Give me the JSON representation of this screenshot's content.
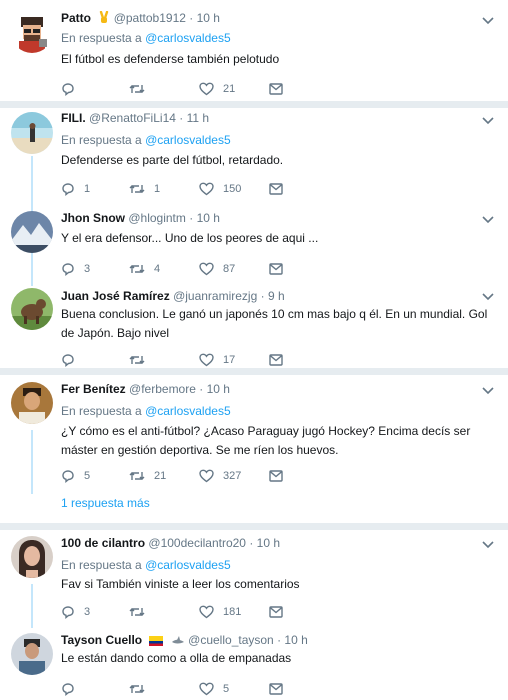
{
  "tweets": [
    {
      "name": "Patto",
      "handle": "@pattob1912",
      "time": "10 h",
      "reply_prefix": "En respuesta a",
      "reply_to": "@carlosvaldes5",
      "text": "El fútbol es defenderse también pelotudo",
      "replies": "",
      "retweets": "",
      "likes": "21"
    },
    {
      "name": "FILI.",
      "handle": "@RenattoFiLi14",
      "time": "11 h",
      "reply_prefix": "En respuesta a",
      "reply_to": "@carlosvaldes5",
      "text": "Defenderse es parte del fútbol, retardado.",
      "replies": "1",
      "retweets": "1",
      "likes": "150"
    },
    {
      "name": "Jhon Snow",
      "handle": "@hlogintm",
      "time": "10 h",
      "text": "Y el era defensor... Uno de los peores de aqui ...",
      "replies": "3",
      "retweets": "4",
      "likes": "87"
    },
    {
      "name": "Juan José Ramírez",
      "handle": "@juanramirezjg",
      "time": "9 h",
      "text_lines": [
        "Buena conclusion. Le ganó un japonés 10 cm mas bajo q él. En un mundial. Gol",
        "de Japón. Bajo nivel"
      ],
      "replies": "",
      "retweets": "",
      "likes": "17"
    },
    {
      "name": "Fer Benítez",
      "handle": "@ferbemore",
      "time": "10 h",
      "reply_prefix": "En respuesta a",
      "reply_to": "@carlosvaldes5",
      "text_lines": [
        "¿Y cómo es el anti-fútbol? ¿Acaso Paraguay jugó Hockey? Encima decís ser",
        "máster en gestión deportiva. Se me ríen los huevos."
      ],
      "replies": "5",
      "retweets": "21",
      "likes": "327",
      "more_replies": "1 respuesta más"
    },
    {
      "name": "100 de cilantro",
      "handle": "@100decilantro20",
      "time": "10 h",
      "reply_prefix": "En respuesta a",
      "reply_to": "@carlosvaldes5",
      "text": "Fav si También viniste a leer los comentarios",
      "replies": "3",
      "retweets": "",
      "likes": "181"
    },
    {
      "name": "Tayson Cuello",
      "handle": "@cuello_tayson",
      "time": "10 h",
      "text": "Le están dando como a olla de empanadas",
      "replies": "",
      "retweets": "",
      "likes": "5"
    }
  ],
  "separator_dot": "·",
  "colors": {
    "link": "#1da1f2",
    "muted": "#657786",
    "thread_line": "#c4e6fb",
    "divider": "#e6ecf0"
  }
}
